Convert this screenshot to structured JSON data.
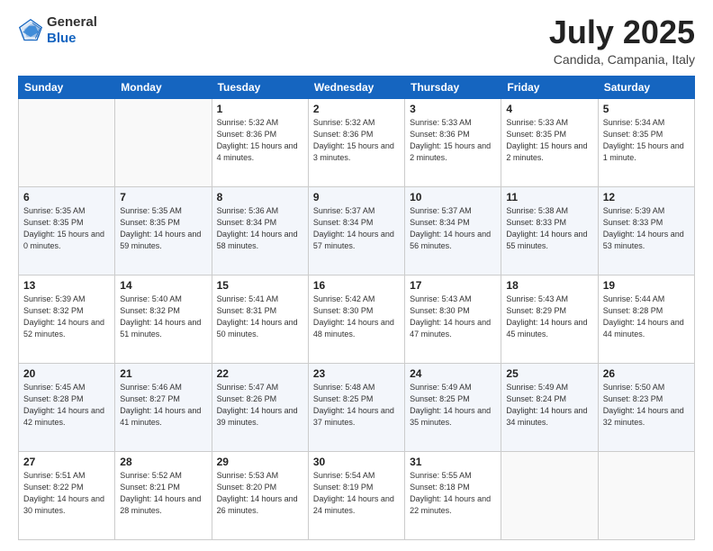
{
  "header": {
    "logo_general": "General",
    "logo_blue": "Blue",
    "month": "July 2025",
    "location": "Candida, Campania, Italy"
  },
  "weekdays": [
    "Sunday",
    "Monday",
    "Tuesday",
    "Wednesday",
    "Thursday",
    "Friday",
    "Saturday"
  ],
  "weeks": [
    [
      {
        "day": "",
        "sunrise": "",
        "sunset": "",
        "daylight": ""
      },
      {
        "day": "",
        "sunrise": "",
        "sunset": "",
        "daylight": ""
      },
      {
        "day": "1",
        "sunrise": "Sunrise: 5:32 AM",
        "sunset": "Sunset: 8:36 PM",
        "daylight": "Daylight: 15 hours and 4 minutes."
      },
      {
        "day": "2",
        "sunrise": "Sunrise: 5:32 AM",
        "sunset": "Sunset: 8:36 PM",
        "daylight": "Daylight: 15 hours and 3 minutes."
      },
      {
        "day": "3",
        "sunrise": "Sunrise: 5:33 AM",
        "sunset": "Sunset: 8:36 PM",
        "daylight": "Daylight: 15 hours and 2 minutes."
      },
      {
        "day": "4",
        "sunrise": "Sunrise: 5:33 AM",
        "sunset": "Sunset: 8:35 PM",
        "daylight": "Daylight: 15 hours and 2 minutes."
      },
      {
        "day": "5",
        "sunrise": "Sunrise: 5:34 AM",
        "sunset": "Sunset: 8:35 PM",
        "daylight": "Daylight: 15 hours and 1 minute."
      }
    ],
    [
      {
        "day": "6",
        "sunrise": "Sunrise: 5:35 AM",
        "sunset": "Sunset: 8:35 PM",
        "daylight": "Daylight: 15 hours and 0 minutes."
      },
      {
        "day": "7",
        "sunrise": "Sunrise: 5:35 AM",
        "sunset": "Sunset: 8:35 PM",
        "daylight": "Daylight: 14 hours and 59 minutes."
      },
      {
        "day": "8",
        "sunrise": "Sunrise: 5:36 AM",
        "sunset": "Sunset: 8:34 PM",
        "daylight": "Daylight: 14 hours and 58 minutes."
      },
      {
        "day": "9",
        "sunrise": "Sunrise: 5:37 AM",
        "sunset": "Sunset: 8:34 PM",
        "daylight": "Daylight: 14 hours and 57 minutes."
      },
      {
        "day": "10",
        "sunrise": "Sunrise: 5:37 AM",
        "sunset": "Sunset: 8:34 PM",
        "daylight": "Daylight: 14 hours and 56 minutes."
      },
      {
        "day": "11",
        "sunrise": "Sunrise: 5:38 AM",
        "sunset": "Sunset: 8:33 PM",
        "daylight": "Daylight: 14 hours and 55 minutes."
      },
      {
        "day": "12",
        "sunrise": "Sunrise: 5:39 AM",
        "sunset": "Sunset: 8:33 PM",
        "daylight": "Daylight: 14 hours and 53 minutes."
      }
    ],
    [
      {
        "day": "13",
        "sunrise": "Sunrise: 5:39 AM",
        "sunset": "Sunset: 8:32 PM",
        "daylight": "Daylight: 14 hours and 52 minutes."
      },
      {
        "day": "14",
        "sunrise": "Sunrise: 5:40 AM",
        "sunset": "Sunset: 8:32 PM",
        "daylight": "Daylight: 14 hours and 51 minutes."
      },
      {
        "day": "15",
        "sunrise": "Sunrise: 5:41 AM",
        "sunset": "Sunset: 8:31 PM",
        "daylight": "Daylight: 14 hours and 50 minutes."
      },
      {
        "day": "16",
        "sunrise": "Sunrise: 5:42 AM",
        "sunset": "Sunset: 8:30 PM",
        "daylight": "Daylight: 14 hours and 48 minutes."
      },
      {
        "day": "17",
        "sunrise": "Sunrise: 5:43 AM",
        "sunset": "Sunset: 8:30 PM",
        "daylight": "Daylight: 14 hours and 47 minutes."
      },
      {
        "day": "18",
        "sunrise": "Sunrise: 5:43 AM",
        "sunset": "Sunset: 8:29 PM",
        "daylight": "Daylight: 14 hours and 45 minutes."
      },
      {
        "day": "19",
        "sunrise": "Sunrise: 5:44 AM",
        "sunset": "Sunset: 8:28 PM",
        "daylight": "Daylight: 14 hours and 44 minutes."
      }
    ],
    [
      {
        "day": "20",
        "sunrise": "Sunrise: 5:45 AM",
        "sunset": "Sunset: 8:28 PM",
        "daylight": "Daylight: 14 hours and 42 minutes."
      },
      {
        "day": "21",
        "sunrise": "Sunrise: 5:46 AM",
        "sunset": "Sunset: 8:27 PM",
        "daylight": "Daylight: 14 hours and 41 minutes."
      },
      {
        "day": "22",
        "sunrise": "Sunrise: 5:47 AM",
        "sunset": "Sunset: 8:26 PM",
        "daylight": "Daylight: 14 hours and 39 minutes."
      },
      {
        "day": "23",
        "sunrise": "Sunrise: 5:48 AM",
        "sunset": "Sunset: 8:25 PM",
        "daylight": "Daylight: 14 hours and 37 minutes."
      },
      {
        "day": "24",
        "sunrise": "Sunrise: 5:49 AM",
        "sunset": "Sunset: 8:25 PM",
        "daylight": "Daylight: 14 hours and 35 minutes."
      },
      {
        "day": "25",
        "sunrise": "Sunrise: 5:49 AM",
        "sunset": "Sunset: 8:24 PM",
        "daylight": "Daylight: 14 hours and 34 minutes."
      },
      {
        "day": "26",
        "sunrise": "Sunrise: 5:50 AM",
        "sunset": "Sunset: 8:23 PM",
        "daylight": "Daylight: 14 hours and 32 minutes."
      }
    ],
    [
      {
        "day": "27",
        "sunrise": "Sunrise: 5:51 AM",
        "sunset": "Sunset: 8:22 PM",
        "daylight": "Daylight: 14 hours and 30 minutes."
      },
      {
        "day": "28",
        "sunrise": "Sunrise: 5:52 AM",
        "sunset": "Sunset: 8:21 PM",
        "daylight": "Daylight: 14 hours and 28 minutes."
      },
      {
        "day": "29",
        "sunrise": "Sunrise: 5:53 AM",
        "sunset": "Sunset: 8:20 PM",
        "daylight": "Daylight: 14 hours and 26 minutes."
      },
      {
        "day": "30",
        "sunrise": "Sunrise: 5:54 AM",
        "sunset": "Sunset: 8:19 PM",
        "daylight": "Daylight: 14 hours and 24 minutes."
      },
      {
        "day": "31",
        "sunrise": "Sunrise: 5:55 AM",
        "sunset": "Sunset: 8:18 PM",
        "daylight": "Daylight: 14 hours and 22 minutes."
      },
      {
        "day": "",
        "sunrise": "",
        "sunset": "",
        "daylight": ""
      },
      {
        "day": "",
        "sunrise": "",
        "sunset": "",
        "daylight": ""
      }
    ]
  ]
}
